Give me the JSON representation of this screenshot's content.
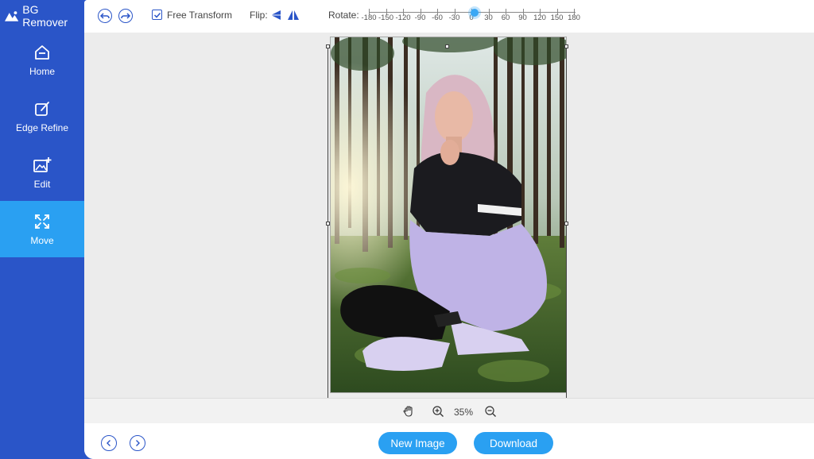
{
  "app": {
    "title": "BG Remover"
  },
  "sidebar": {
    "items": [
      {
        "label": "Home",
        "icon": "home-icon",
        "active": false
      },
      {
        "label": "Edge Refine",
        "icon": "edge-refine-icon",
        "active": false
      },
      {
        "label": "Edit",
        "icon": "edit-image-icon",
        "active": false
      },
      {
        "label": "Move",
        "icon": "move-icon",
        "active": true
      }
    ]
  },
  "toolbar": {
    "undo_icon": "undo-icon",
    "redo_icon": "redo-icon",
    "free_transform_label": "Free Transform",
    "free_transform_checked": true,
    "flip_label": "Flip:",
    "rotate_label": "Rotate:",
    "rotate_ticks": [
      "-180",
      "-150",
      "-120",
      "-90",
      "-60",
      "-30",
      "0",
      "30",
      "60",
      "90",
      "120",
      "150",
      "180"
    ],
    "rotate_value": "0"
  },
  "canvas": {
    "image_description_icon": "photo-preview"
  },
  "zoom": {
    "pan_icon": "hand-icon",
    "zoom_in_icon": "zoom-in-icon",
    "value": "35%",
    "zoom_out_icon": "zoom-out-icon"
  },
  "bottom": {
    "new_image_label": "New Image",
    "download_label": "Download"
  },
  "colors": {
    "sidebar_bg": "#2a55c8",
    "accent": "#2aa0f2",
    "canvas_bg": "#ececec"
  }
}
